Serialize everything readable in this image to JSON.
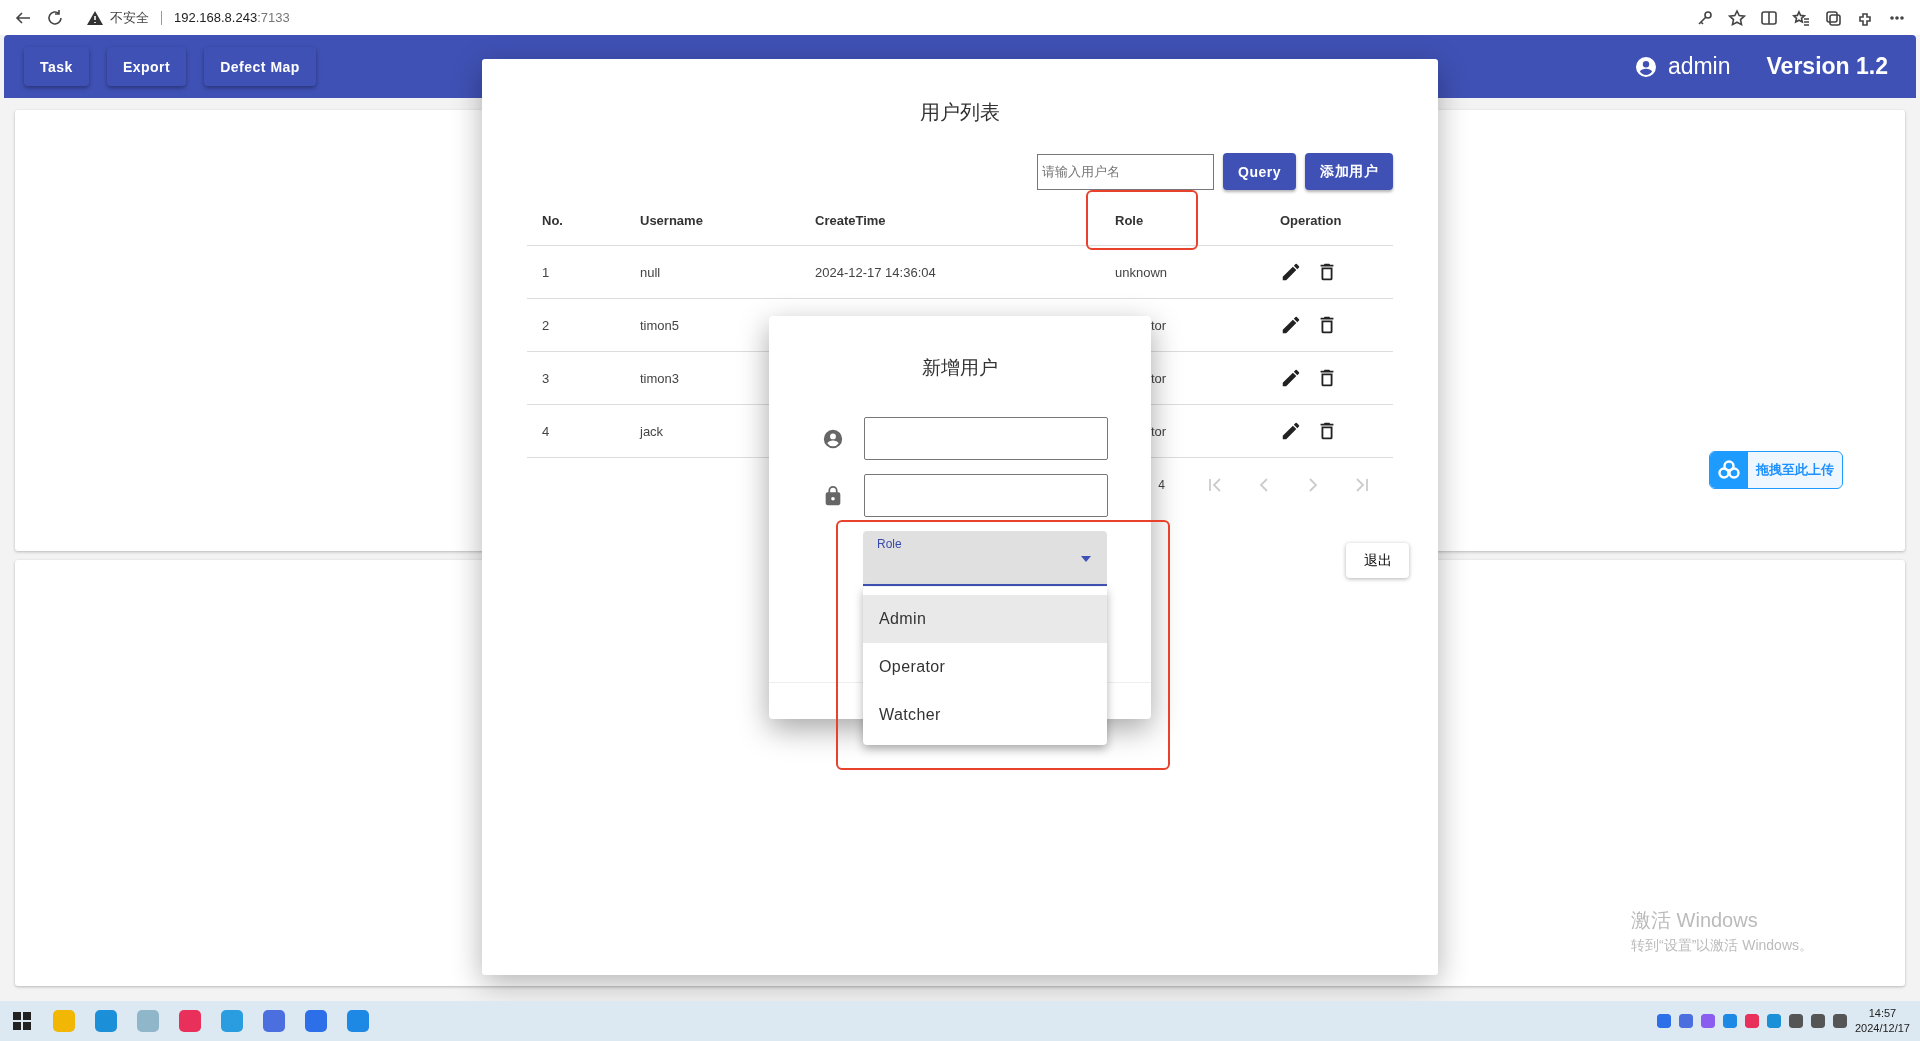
{
  "browser": {
    "security_label": "不安全",
    "url_host": "192.168.8.243",
    "url_port": ":7133"
  },
  "app_header": {
    "nav_buttons": [
      "Task",
      "Export",
      "Defect Map"
    ],
    "user": "admin",
    "version": "Version 1.2"
  },
  "upload_badge": {
    "label": "拖拽至此上传"
  },
  "user_list_dialog": {
    "title": "用户列表",
    "search": {
      "placeholder": "请输入用户名"
    },
    "buttons": [
      "Query",
      "添加用户"
    ],
    "table": {
      "columns": [
        {
          "label": "No.",
          "highlighted": false
        },
        {
          "label": "Username",
          "highlighted": false
        },
        {
          "label": "CreateTime",
          "highlighted": false
        },
        {
          "label": "Role",
          "highlighted": true
        },
        {
          "label": "Operation",
          "highlighted": false
        }
      ],
      "rows": [
        {
          "no": "1",
          "username": "null",
          "create_time": "2024-12-17 14:36:04",
          "role": "unknown",
          "role_partial": false
        },
        {
          "no": "2",
          "username": "timon5",
          "role": "tor",
          "role_partial": true
        },
        {
          "no": "3",
          "username": "timon3",
          "role": "tor",
          "role_partial": true
        },
        {
          "no": "4",
          "username": "jack",
          "role": "tor",
          "role_partial": true
        }
      ]
    },
    "pagination": {
      "range_text": "4",
      "controls": [
        {
          "kind": "first",
          "disabled": true
        },
        {
          "kind": "prev",
          "disabled": true
        },
        {
          "kind": "next",
          "disabled": true
        },
        {
          "kind": "last",
          "disabled": true
        }
      ]
    },
    "exit_button": "退出"
  },
  "add_user_dialog": {
    "title": "新增用户",
    "fields": [
      {
        "kind": "username"
      },
      {
        "kind": "password"
      }
    ],
    "role_select": {
      "label": "Role",
      "focused": true,
      "highlighted": true,
      "options": [
        {
          "label": "Admin",
          "selected": true
        },
        {
          "label": "Operator",
          "selected": false
        },
        {
          "label": "Watcher",
          "selected": false
        }
      ]
    }
  },
  "windows_watermark": {
    "title": "激活 Windows",
    "subtitle": "转到“设置”以激活 Windows。"
  },
  "taskbar": {
    "time": "14:57",
    "date": "2024/12/17"
  }
}
